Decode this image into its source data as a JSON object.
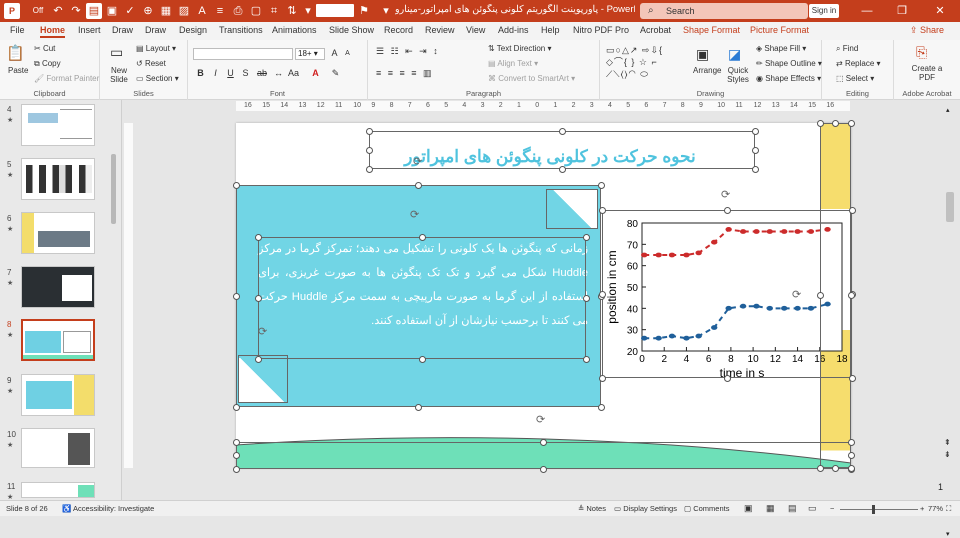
{
  "titlebar": {
    "autosave": "Off",
    "document_title": "پاورپوینت الگوریتم کلونی پنگوئن های امپراتور-مینارو",
    "app": "PowerPoint",
    "search_placeholder": "Search",
    "signin": "Sign in"
  },
  "tabs": [
    "File",
    "Home",
    "Insert",
    "Draw",
    "Draw",
    "Design",
    "Transitions",
    "Animations",
    "Slide Show",
    "Record",
    "Review",
    "View",
    "Add-ins",
    "Help",
    "Nitro PDF Pro",
    "Acrobat",
    "Shape Format",
    "Picture Format"
  ],
  "share": "Share",
  "ribbon": {
    "clipboard": {
      "paste": "Paste",
      "cut": "Cut",
      "copy": "Copy",
      "format_painter": "Format Painter",
      "label": "Clipboard"
    },
    "slides": {
      "new_slide": "New Slide",
      "layout": "Layout",
      "reset": "Reset",
      "section": "Section",
      "label": "Slides"
    },
    "font": {
      "size": "18+",
      "label": "Font",
      "bold": "B",
      "italic": "I",
      "underline": "U",
      "strike": "S",
      "shadow": "ab",
      "grow": "A",
      "shrink": "A"
    },
    "paragraph": {
      "text_direction": "Text Direction",
      "align_text": "Align Text",
      "convert": "Convert to SmartArt",
      "label": "Paragraph"
    },
    "drawing": {
      "arrange": "Arrange",
      "quick_styles": "Quick Styles",
      "shape_fill": "Shape Fill",
      "shape_outline": "Shape Outline",
      "shape_effects": "Shape Effects",
      "label": "Drawing"
    },
    "editing": {
      "find": "Find",
      "replace": "Replace",
      "select": "Select",
      "label": "Editing"
    },
    "acrobat": {
      "create_pdf": "Create a PDF",
      "label": "Adobe Acrobat"
    }
  },
  "thumbnails": [
    {
      "num": "4"
    },
    {
      "num": "5"
    },
    {
      "num": "6"
    },
    {
      "num": "7"
    },
    {
      "num": "8",
      "selected": true
    },
    {
      "num": "9"
    },
    {
      "num": "10"
    },
    {
      "num": "11"
    }
  ],
  "slide": {
    "title": "نحوه حرکت در کلونی پنگوئن های امپراتور",
    "body": "زمانی که پنگوئن ها یک کلونی را تشکیل می دهند؛ تمرکز گرما در مرکز Huddle شکل می گیرد و تک تک پنگوئن ها به صورت غریزی، برای استفاده از این گرما به صورت مارپیچی به سمت مرکز Huddle حرکت می کنند تا برحسب نیازشان از آن استفاده کنند."
  },
  "chart_data": {
    "type": "line",
    "xlabel": "time in s",
    "ylabel": "position in cm",
    "xlim": [
      0,
      18
    ],
    "ylim": [
      20,
      80
    ],
    "xticks": [
      "0",
      "2",
      "4",
      "6",
      "8",
      "10",
      "12",
      "14",
      "16",
      "18"
    ],
    "yticks": [
      "20",
      "30",
      "40",
      "50",
      "60",
      "70",
      "80"
    ],
    "series": [
      {
        "color": "#cc2b2b",
        "x": [
          0.2,
          1.5,
          2.7,
          4.0,
          5.1,
          6.5,
          7.8,
          9.1,
          10.3,
          11.5,
          12.8,
          14.0,
          15.2,
          16.7
        ],
        "y": [
          65,
          65,
          65,
          65,
          66,
          71,
          77,
          76,
          76,
          76,
          76,
          76,
          76,
          77
        ]
      },
      {
        "color": "#1f5f9a",
        "x": [
          0.2,
          1.5,
          2.7,
          4.0,
          5.1,
          6.5,
          7.8,
          9.1,
          10.3,
          11.5,
          12.8,
          14.0,
          15.2,
          16.7
        ],
        "y": [
          26,
          26,
          27,
          26,
          27,
          31,
          40,
          41,
          41,
          40,
          40,
          40,
          40,
          42
        ]
      }
    ]
  },
  "ruler_numbers": [
    "16",
    "15",
    "14",
    "13",
    "12",
    "11",
    "10",
    "9",
    "8",
    "7",
    "6",
    "5",
    "4",
    "3",
    "2",
    "1",
    "0",
    "1",
    "2",
    "3",
    "4",
    "5",
    "6",
    "7",
    "8",
    "9",
    "10",
    "11",
    "12",
    "13",
    "14",
    "15",
    "16"
  ],
  "status": {
    "slide": "Slide 8 of 26",
    "accessibility": "Accessibility: Investigate",
    "notes": "Notes",
    "display": "Display Settings",
    "comments": "Comments",
    "zoom": "77%"
  },
  "page_num": "1"
}
